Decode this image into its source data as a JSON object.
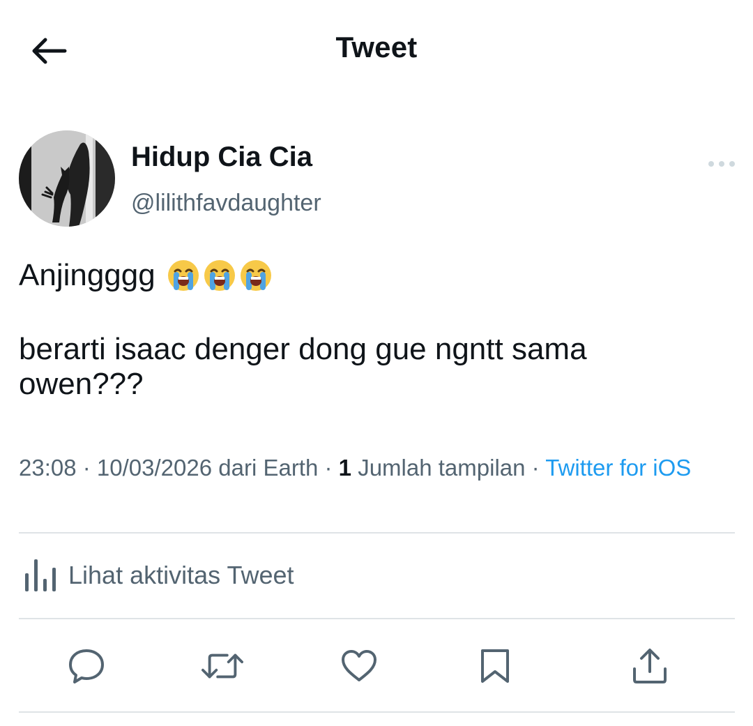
{
  "header": {
    "title": "Tweet",
    "back_icon": "arrow-left-icon"
  },
  "author": {
    "display_name": "Hidup Cia Cia",
    "handle": "@lilithfavdaughter",
    "more_icon": "more-horizontal-icon"
  },
  "tweet": {
    "line1": "Anjingggg",
    "emojis": [
      "loudly-crying-face",
      "loudly-crying-face",
      "loudly-crying-face"
    ],
    "line2": "berarti isaac denger dong gue ngntt sama owen???"
  },
  "meta": {
    "time": "23:08",
    "sep1": " · ",
    "date": "10/03/2026",
    "location": " dari Earth",
    "sep2": " · ",
    "views_count": "1",
    "views_label": " Jumlah tampilan",
    "sep3": " · ",
    "source": "Twitter for iOS"
  },
  "activity": {
    "label": "Lihat aktivitas Tweet",
    "icon": "analytics-bars-icon"
  },
  "actions": [
    {
      "name": "reply",
      "icon": "reply-icon"
    },
    {
      "name": "retweet",
      "icon": "retweet-icon"
    },
    {
      "name": "like",
      "icon": "heart-icon"
    },
    {
      "name": "bookmark",
      "icon": "bookmark-icon"
    },
    {
      "name": "share",
      "icon": "share-icon"
    }
  ],
  "colors": {
    "text": "#0f1419",
    "secondary": "#536471",
    "accent": "#1d9bf0",
    "divider": "#dfe3e6",
    "emoji": "#f7c948"
  }
}
